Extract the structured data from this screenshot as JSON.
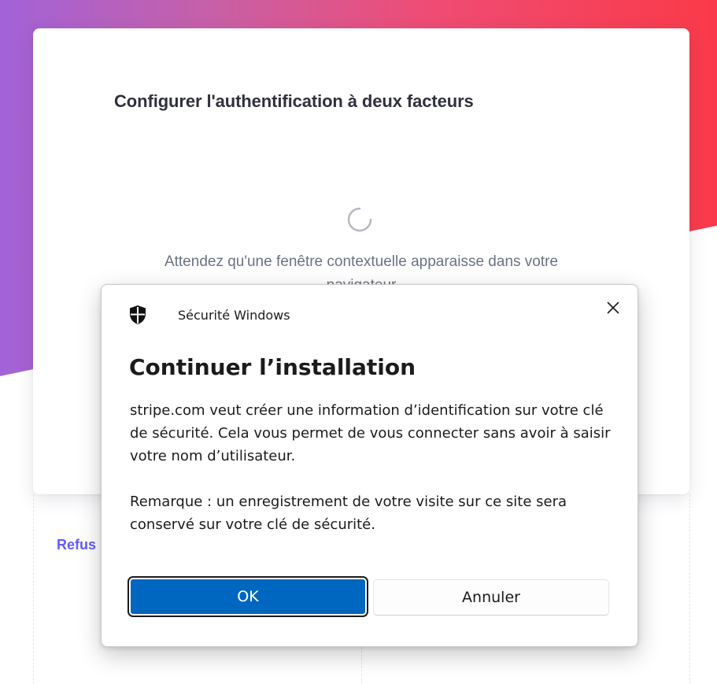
{
  "page": {
    "title": "Configurer l'authentification à deux facteurs",
    "wait_message": "Attendez qu'une fenêtre contextuelle apparaisse dans votre navigateur",
    "refuse_link": "Refus",
    "accent_color": "#635bff"
  },
  "dialog": {
    "app_name": "Sécurité Windows",
    "heading": "Continuer l’installation",
    "paragraph_1": "stripe.com veut créer une information d’identification sur votre clé de sécurité. Cela vous permet de vous connecter sans avoir à saisir votre nom d’utilisateur.",
    "paragraph_2": "Remarque : un enregistrement de votre visite sur ce site sera conservé sur votre clé de sécurité.",
    "ok_label": "OK",
    "cancel_label": "Annuler",
    "close_icon": "close-icon",
    "shield_icon": "shield-icon",
    "ok_color": "#0067c0"
  }
}
